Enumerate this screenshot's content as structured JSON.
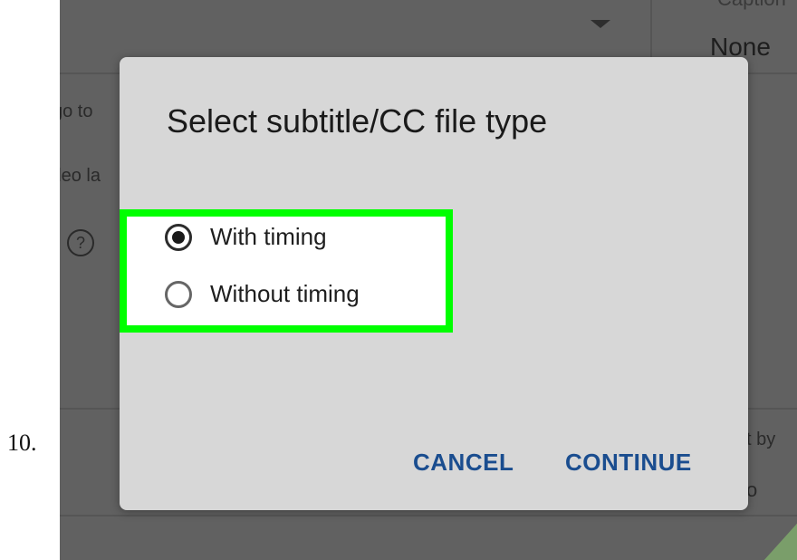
{
  "step": {
    "number": "10."
  },
  "background": {
    "caption_label": "Caption",
    "caption_value": "None",
    "left_text_1": "go to",
    "left_text_2": "ideo la",
    "help_icon": "?",
    "right_text_1": "t by",
    "right_text_2": "o"
  },
  "dialog": {
    "title": "Select subtitle/CC file type",
    "options": [
      {
        "label": "With timing",
        "selected": true
      },
      {
        "label": "Without timing",
        "selected": false
      }
    ],
    "cancel_label": "CANCEL",
    "continue_label": "CONTINUE"
  },
  "colors": {
    "highlight": "#00ff00",
    "button_text": "#1a4d8f",
    "dialog_bg": "#d7d7d7",
    "overlay_bg": "#616161"
  },
  "icons": {
    "dropdown": "chevron-down-icon",
    "help": "help-circle-icon"
  }
}
